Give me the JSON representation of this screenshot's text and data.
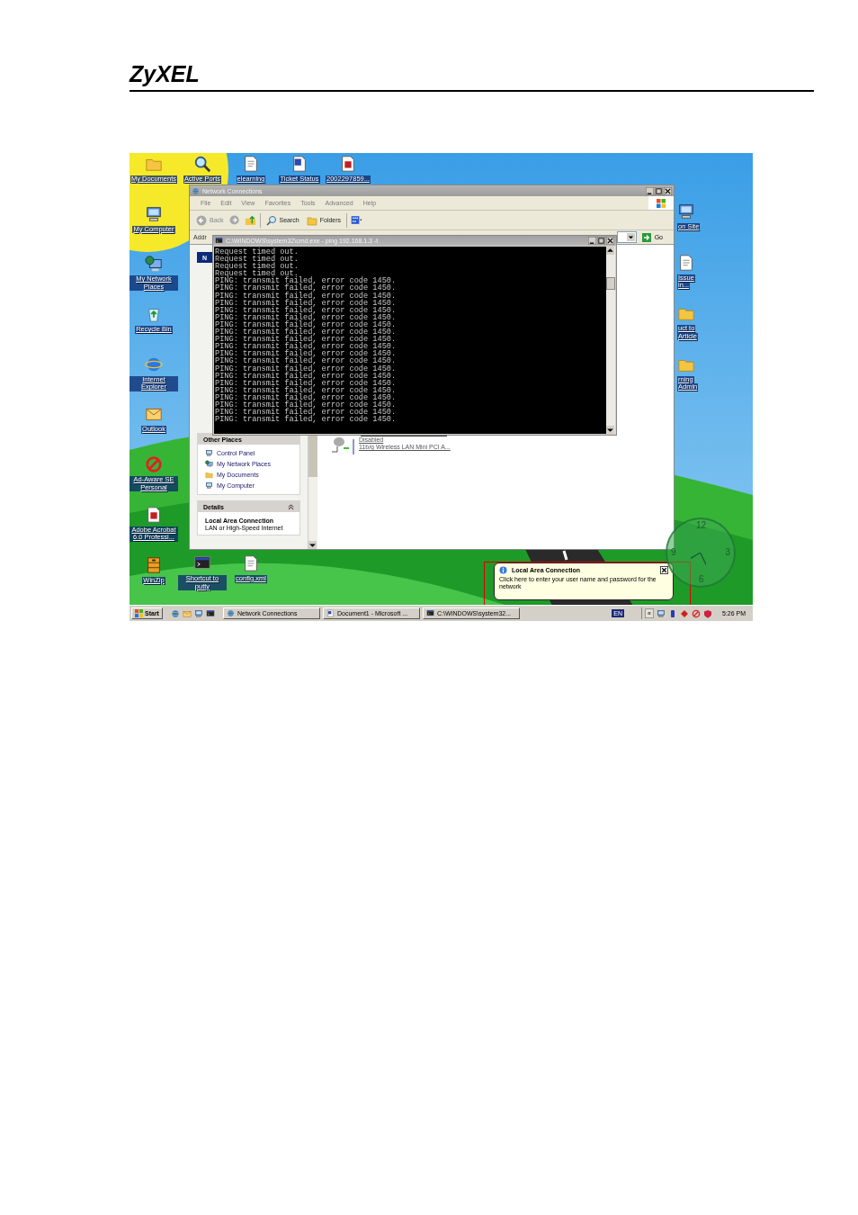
{
  "document": {
    "logo": "ZyXEL"
  },
  "desktop": {
    "left_icons": [
      {
        "label": "My Documents",
        "kind": "folder"
      },
      {
        "label": "My Computer",
        "kind": "computer"
      },
      {
        "label": "My Network Places",
        "kind": "globe-computer"
      },
      {
        "label": "Recycle Bin",
        "kind": "recycle-bin"
      },
      {
        "label": "Internet Explorer",
        "kind": "globe"
      },
      {
        "label": "Outlook",
        "kind": "envelope"
      },
      {
        "label": "Ad-Aware SE Personal",
        "kind": "no-sign"
      },
      {
        "label": "Adobe Acrobat 6.0 Professi...",
        "kind": "pdf-page"
      },
      {
        "label": "WinZip",
        "kind": "cabinet"
      }
    ],
    "top_icons": [
      {
        "label": "Active Ports",
        "kind": "magnifier"
      },
      {
        "label": "elearning",
        "kind": "page"
      },
      {
        "label": "Ticket Status",
        "kind": "word-page"
      },
      {
        "label": "2002297859...",
        "kind": "pdf-page"
      }
    ],
    "bottom_icons": [
      {
        "label": "Shortcut to putty",
        "kind": "terminal"
      },
      {
        "label": "config.xml",
        "kind": "page"
      }
    ],
    "right_icons": [
      {
        "kind": "computer",
        "lines": [
          "on Site"
        ]
      },
      {
        "kind": "page",
        "lines": [
          "Issue",
          "in..."
        ]
      },
      {
        "kind": "folder",
        "lines": [
          "uct to",
          "Article"
        ]
      },
      {
        "kind": "folder",
        "lines": [
          "rning",
          "Admin"
        ]
      }
    ]
  },
  "explorer": {
    "title": "Network Connections",
    "menu": [
      "File",
      "Edit",
      "View",
      "Favorites",
      "Tools",
      "Advanced",
      "Help"
    ],
    "toolbar": {
      "back": "Back",
      "search": "Search",
      "folders": "Folders"
    },
    "address": {
      "label": "Addr",
      "go": "Go"
    },
    "network_tasks": {
      "title": "N"
    },
    "other_places": {
      "title": "Other Places",
      "items": [
        {
          "label": "Control Panel",
          "kind": "computer"
        },
        {
          "label": "My Network Places",
          "kind": "globe-computer"
        },
        {
          "label": "My Documents",
          "kind": "folder"
        },
        {
          "label": "My Computer",
          "kind": "computer"
        }
      ]
    },
    "details": {
      "title": "Details",
      "name": "Local Area Connection",
      "type": "LAN or High-Speed Internet"
    },
    "connection": {
      "status": "Disabled",
      "device": "11b/g Wireless LAN Mini PCI A..."
    }
  },
  "console": {
    "title": "C:\\WINDOWS\\system32\\cmd.exe - ping 192.168.1.3 -t",
    "lines": [
      "Request timed out.",
      "Request timed out.",
      "Request timed out.",
      "Request timed out.",
      "PING: transmit failed, error code 1450.",
      "PING: transmit failed, error code 1450.",
      "PING: transmit failed, error code 1450.",
      "PING: transmit failed, error code 1450.",
      "PING: transmit failed, error code 1450.",
      "PING: transmit failed, error code 1450.",
      "PING: transmit failed, error code 1450.",
      "PING: transmit failed, error code 1450.",
      "PING: transmit failed, error code 1450.",
      "PING: transmit failed, error code 1450.",
      "PING: transmit failed, error code 1450.",
      "PING: transmit failed, error code 1450.",
      "PING: transmit failed, error code 1450.",
      "PING: transmit failed, error code 1450.",
      "PING: transmit failed, error code 1450.",
      "PING: transmit failed, error code 1450.",
      "PING: transmit failed, error code 1450.",
      "PING: transmit failed, error code 1450.",
      "PING: transmit failed, error code 1450.",
      "PING: transmit failed, error code 1450."
    ]
  },
  "clock": {
    "numerals": [
      "12",
      "3",
      "6",
      "9"
    ]
  },
  "balloon": {
    "title": "Local Area Connection",
    "text": "Click here to enter your user name and password for the network"
  },
  "taskbar": {
    "start": "Start",
    "buttons": [
      {
        "label": "Network Connections",
        "kind": "globe"
      },
      {
        "label": "Document1 - Microsoft ...",
        "kind": "word-page"
      },
      {
        "label": "C:\\WINDOWS\\system32...",
        "kind": "terminal"
      }
    ],
    "language": "EN",
    "expand": "«",
    "time": "5:26 PM"
  }
}
